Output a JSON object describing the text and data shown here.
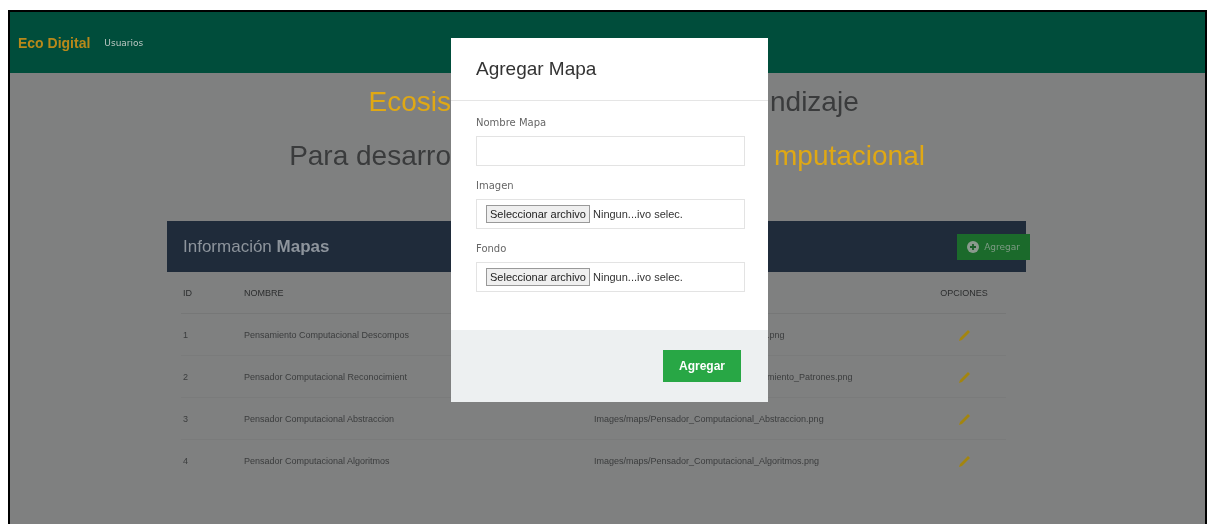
{
  "navbar": {
    "brand": "Eco Digital",
    "items": [
      {
        "label": "Usuarios"
      }
    ]
  },
  "heading_lines": [
    {
      "left": {
        "text": "Ecosis",
        "accent": true
      },
      "right": {
        "text": "ndizaje",
        "accent": false
      }
    },
    {
      "left": {
        "text": "Para desarro",
        "accent": false
      },
      "right": {
        "text": "mputacional",
        "accent": true
      }
    }
  ],
  "panel": {
    "title": "Información **Mapas**",
    "add_button": "Agregar",
    "columns": {
      "id": "ID",
      "name": "NOMBRE",
      "options": "OPCIONES"
    },
    "rows": [
      {
        "id": "1",
        "name": "Pensamiento Computacional Descompos",
        "path": ".png",
        "path_partial": true
      },
      {
        "id": "2",
        "name": "Pensador Computacional Reconocimient",
        "path": "miento_Patrones.png",
        "path_partial": true
      },
      {
        "id": "3",
        "name": "Pensador Computacional Abstraccion",
        "path": "Images/maps/Pensador_Computacional_Abstraccion.png",
        "path_partial": false
      },
      {
        "id": "4",
        "name": "Pensador Computacional Algoritmos",
        "path": "Images/maps/Pensador_Computacional_Algoritmos.png",
        "path_partial": false
      }
    ]
  },
  "modal": {
    "title": "Agregar Mapa",
    "fields": [
      {
        "kind": "text",
        "label": "Nombre Mapa"
      },
      {
        "kind": "file",
        "label": "Imagen",
        "button": "Seleccionar archivo",
        "value": "Ningun...ivo selec."
      },
      {
        "kind": "file",
        "label": "Fondo",
        "button": "Seleccionar archivo",
        "value": "Ningun...ivo selec."
      }
    ],
    "submit": "Agregar"
  }
}
